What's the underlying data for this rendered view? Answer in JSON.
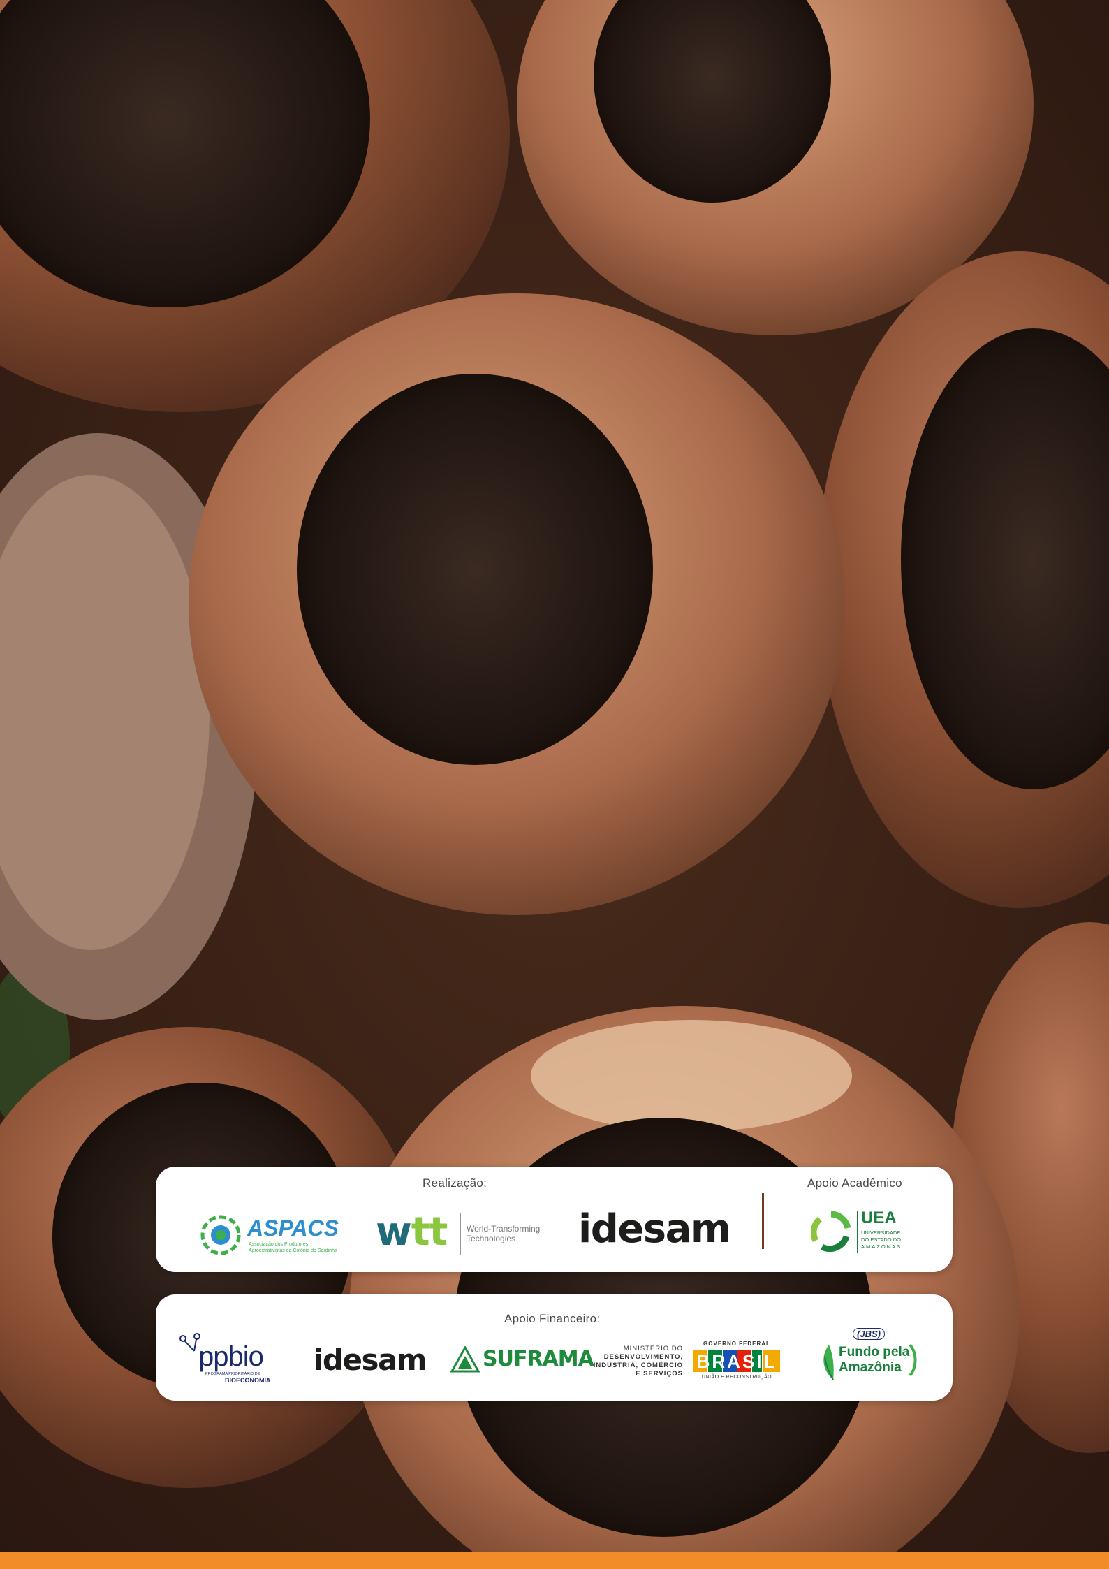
{
  "cover": {
    "background": "photo-of-empty-brazil-nut-pods",
    "accent_color": "#f28c28"
  },
  "realizacao": {
    "label": "Realização:",
    "logos": {
      "aspacs": {
        "name": "ASPACS",
        "tagline_1": "Associação dos Produtores",
        "tagline_2": "Agroextrativistas da Colônia do Sardinha",
        "color": "#2f8fce",
        "icon_color": "#3db04b"
      },
      "wtt": {
        "name": "wtt",
        "tagline_1": "World-Transforming",
        "tagline_2": "Technologies",
        "color": "#1f6b7a",
        "accent": "#8cc63f"
      },
      "idesam": {
        "name": "idesam"
      }
    }
  },
  "apoio_academico": {
    "label": "Apoio Acadêmico",
    "uea": {
      "name": "UEA",
      "line_1": "UNIVERSIDADE",
      "line_2": "DO ESTADO DO",
      "line_3": "AMAZONAS",
      "color": "#1a7f3c"
    }
  },
  "apoio_financeiro": {
    "label": "Apoio Financeiro:",
    "logos": {
      "ppbio": {
        "name": "ppbio",
        "subtitle_1": "PROGRAMA PRIORITÁRIO DE",
        "subtitle_2": "BIOECONOMIA",
        "color": "#1b2a6b"
      },
      "idesam": {
        "name": "idesam"
      },
      "suframa": {
        "name": "SUFRAMA",
        "color": "#1e8a3c"
      },
      "mdic": {
        "line_1": "MINISTÉRIO DO",
        "line_2": "DESENVOLVIMENTO,",
        "line_3": "INDÚSTRIA, COMÉRCIO",
        "line_4": "E SERVIÇOS"
      },
      "governo": {
        "top": "GOVERNO FEDERAL",
        "word": "BRASIL",
        "bottom": "UNIÃO E RECONSTRUÇÃO",
        "letter_colors": [
          "#f2a900",
          "#00843d",
          "#1351b4",
          "#e52207",
          "#00843d",
          "#f2a900"
        ]
      },
      "fundo": {
        "badge": "JBS",
        "line_1": "Fundo pela",
        "line_2": "Amazônia",
        "color": "#1a7f3c"
      }
    }
  }
}
